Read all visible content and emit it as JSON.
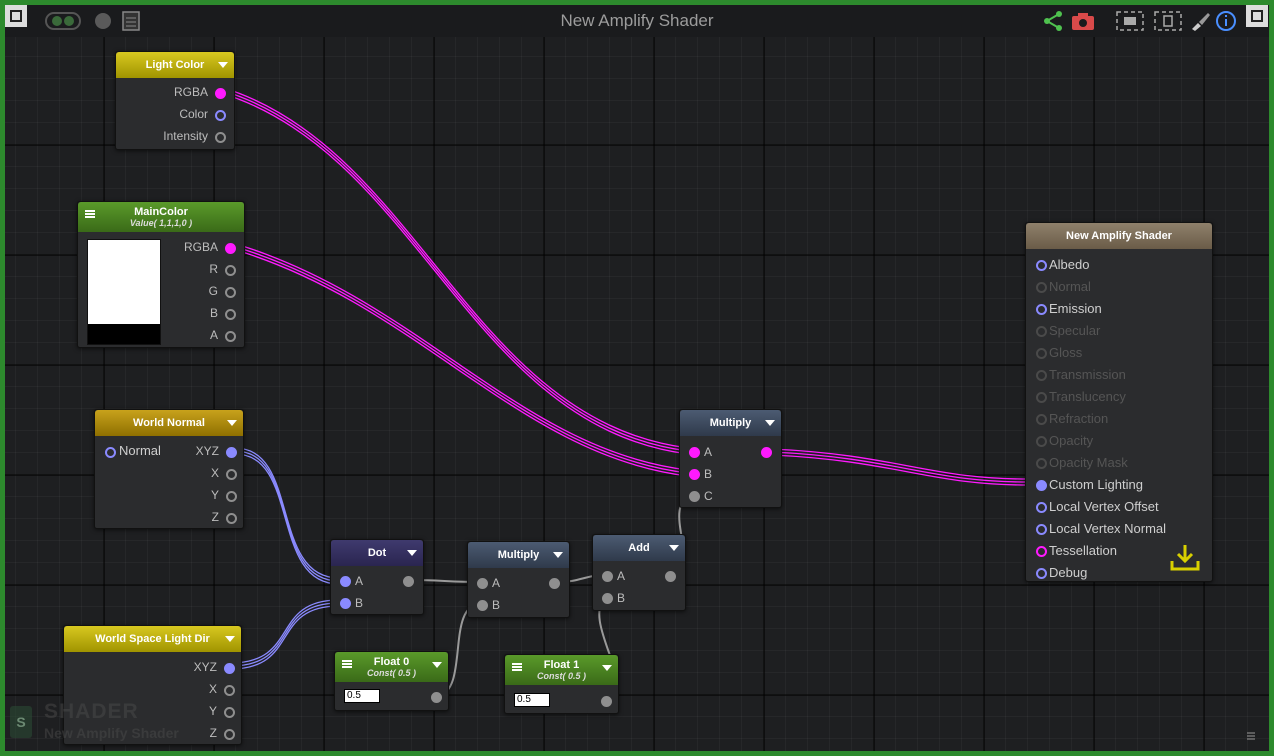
{
  "window": {
    "title": "New Amplify Shader"
  },
  "toolbar": {
    "left_icons": [
      "live-mode-icon",
      "record-icon",
      "document-icon"
    ],
    "right_icons": [
      "share-icon",
      "camera-icon",
      "fit-view-icon",
      "select-view-icon",
      "brush-icon",
      "info-icon"
    ]
  },
  "nodes": {
    "light_color": {
      "title": "Light Color",
      "outputs": [
        "RGBA",
        "Color",
        "Intensity"
      ]
    },
    "main_color": {
      "title": "MainColor",
      "subtitle": "Value( 1,1,1,0 )",
      "outputs": [
        "RGBA",
        "R",
        "G",
        "B",
        "A"
      ]
    },
    "world_normal": {
      "title": "World Normal",
      "input": "Normal",
      "outputs": [
        "XYZ",
        "X",
        "Y",
        "Z"
      ]
    },
    "world_space_light_dir": {
      "title": "World Space Light Dir",
      "outputs": [
        "XYZ",
        "X",
        "Y",
        "Z"
      ]
    },
    "dot": {
      "title": "Dot",
      "inputs": [
        "A",
        "B"
      ]
    },
    "multiply_small": {
      "title": "Multiply",
      "inputs": [
        "A",
        "B"
      ]
    },
    "add": {
      "title": "Add",
      "inputs": [
        "A",
        "B"
      ]
    },
    "float0": {
      "title": "Float 0",
      "subtitle": "Const( 0.5 )",
      "value": "0.5"
    },
    "float1": {
      "title": "Float 1",
      "subtitle": "Const( 0.5 )",
      "value": "0.5"
    },
    "multiply_main": {
      "title": "Multiply",
      "inputs": [
        "A",
        "B",
        "C"
      ]
    },
    "master": {
      "title": "New Amplify Shader",
      "inputs": [
        "Albedo",
        "Normal",
        "Emission",
        "Specular",
        "Gloss",
        "Transmission",
        "Translucency",
        "Refraction",
        "Opacity",
        "Opacity Mask",
        "Custom Lighting",
        "Local Vertex Offset",
        "Local Vertex Normal",
        "Tessellation",
        "Debug"
      ]
    }
  },
  "watermark": {
    "logo": "S",
    "title": "SHADER",
    "subtitle": "New Amplify Shader"
  },
  "colors": {
    "frame": "#2d8a2d",
    "wire_color": "#ff1aff",
    "wire_vector": "#8a8aff",
    "wire_float": "#9a9a9a"
  }
}
